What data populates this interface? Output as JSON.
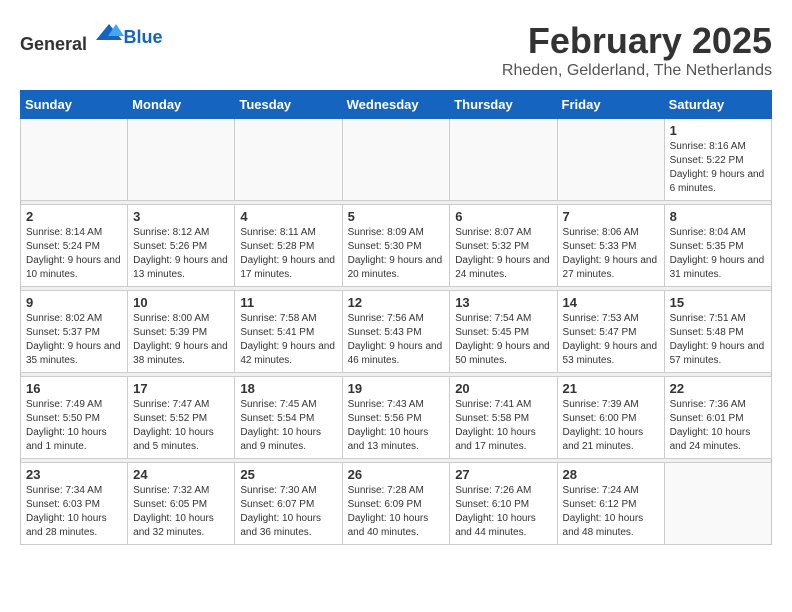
{
  "logo": {
    "general": "General",
    "blue": "Blue"
  },
  "title": "February 2025",
  "location": "Rheden, Gelderland, The Netherlands",
  "weekdays": [
    "Sunday",
    "Monday",
    "Tuesday",
    "Wednesday",
    "Thursday",
    "Friday",
    "Saturday"
  ],
  "weeks": [
    [
      {
        "day": "",
        "info": ""
      },
      {
        "day": "",
        "info": ""
      },
      {
        "day": "",
        "info": ""
      },
      {
        "day": "",
        "info": ""
      },
      {
        "day": "",
        "info": ""
      },
      {
        "day": "",
        "info": ""
      },
      {
        "day": "1",
        "info": "Sunrise: 8:16 AM\nSunset: 5:22 PM\nDaylight: 9 hours and 6 minutes."
      }
    ],
    [
      {
        "day": "2",
        "info": "Sunrise: 8:14 AM\nSunset: 5:24 PM\nDaylight: 9 hours and 10 minutes."
      },
      {
        "day": "3",
        "info": "Sunrise: 8:12 AM\nSunset: 5:26 PM\nDaylight: 9 hours and 13 minutes."
      },
      {
        "day": "4",
        "info": "Sunrise: 8:11 AM\nSunset: 5:28 PM\nDaylight: 9 hours and 17 minutes."
      },
      {
        "day": "5",
        "info": "Sunrise: 8:09 AM\nSunset: 5:30 PM\nDaylight: 9 hours and 20 minutes."
      },
      {
        "day": "6",
        "info": "Sunrise: 8:07 AM\nSunset: 5:32 PM\nDaylight: 9 hours and 24 minutes."
      },
      {
        "day": "7",
        "info": "Sunrise: 8:06 AM\nSunset: 5:33 PM\nDaylight: 9 hours and 27 minutes."
      },
      {
        "day": "8",
        "info": "Sunrise: 8:04 AM\nSunset: 5:35 PM\nDaylight: 9 hours and 31 minutes."
      }
    ],
    [
      {
        "day": "9",
        "info": "Sunrise: 8:02 AM\nSunset: 5:37 PM\nDaylight: 9 hours and 35 minutes."
      },
      {
        "day": "10",
        "info": "Sunrise: 8:00 AM\nSunset: 5:39 PM\nDaylight: 9 hours and 38 minutes."
      },
      {
        "day": "11",
        "info": "Sunrise: 7:58 AM\nSunset: 5:41 PM\nDaylight: 9 hours and 42 minutes."
      },
      {
        "day": "12",
        "info": "Sunrise: 7:56 AM\nSunset: 5:43 PM\nDaylight: 9 hours and 46 minutes."
      },
      {
        "day": "13",
        "info": "Sunrise: 7:54 AM\nSunset: 5:45 PM\nDaylight: 9 hours and 50 minutes."
      },
      {
        "day": "14",
        "info": "Sunrise: 7:53 AM\nSunset: 5:47 PM\nDaylight: 9 hours and 53 minutes."
      },
      {
        "day": "15",
        "info": "Sunrise: 7:51 AM\nSunset: 5:48 PM\nDaylight: 9 hours and 57 minutes."
      }
    ],
    [
      {
        "day": "16",
        "info": "Sunrise: 7:49 AM\nSunset: 5:50 PM\nDaylight: 10 hours and 1 minute."
      },
      {
        "day": "17",
        "info": "Sunrise: 7:47 AM\nSunset: 5:52 PM\nDaylight: 10 hours and 5 minutes."
      },
      {
        "day": "18",
        "info": "Sunrise: 7:45 AM\nSunset: 5:54 PM\nDaylight: 10 hours and 9 minutes."
      },
      {
        "day": "19",
        "info": "Sunrise: 7:43 AM\nSunset: 5:56 PM\nDaylight: 10 hours and 13 minutes."
      },
      {
        "day": "20",
        "info": "Sunrise: 7:41 AM\nSunset: 5:58 PM\nDaylight: 10 hours and 17 minutes."
      },
      {
        "day": "21",
        "info": "Sunrise: 7:39 AM\nSunset: 6:00 PM\nDaylight: 10 hours and 21 minutes."
      },
      {
        "day": "22",
        "info": "Sunrise: 7:36 AM\nSunset: 6:01 PM\nDaylight: 10 hours and 24 minutes."
      }
    ],
    [
      {
        "day": "23",
        "info": "Sunrise: 7:34 AM\nSunset: 6:03 PM\nDaylight: 10 hours and 28 minutes."
      },
      {
        "day": "24",
        "info": "Sunrise: 7:32 AM\nSunset: 6:05 PM\nDaylight: 10 hours and 32 minutes."
      },
      {
        "day": "25",
        "info": "Sunrise: 7:30 AM\nSunset: 6:07 PM\nDaylight: 10 hours and 36 minutes."
      },
      {
        "day": "26",
        "info": "Sunrise: 7:28 AM\nSunset: 6:09 PM\nDaylight: 10 hours and 40 minutes."
      },
      {
        "day": "27",
        "info": "Sunrise: 7:26 AM\nSunset: 6:10 PM\nDaylight: 10 hours and 44 minutes."
      },
      {
        "day": "28",
        "info": "Sunrise: 7:24 AM\nSunset: 6:12 PM\nDaylight: 10 hours and 48 minutes."
      },
      {
        "day": "",
        "info": ""
      }
    ]
  ]
}
